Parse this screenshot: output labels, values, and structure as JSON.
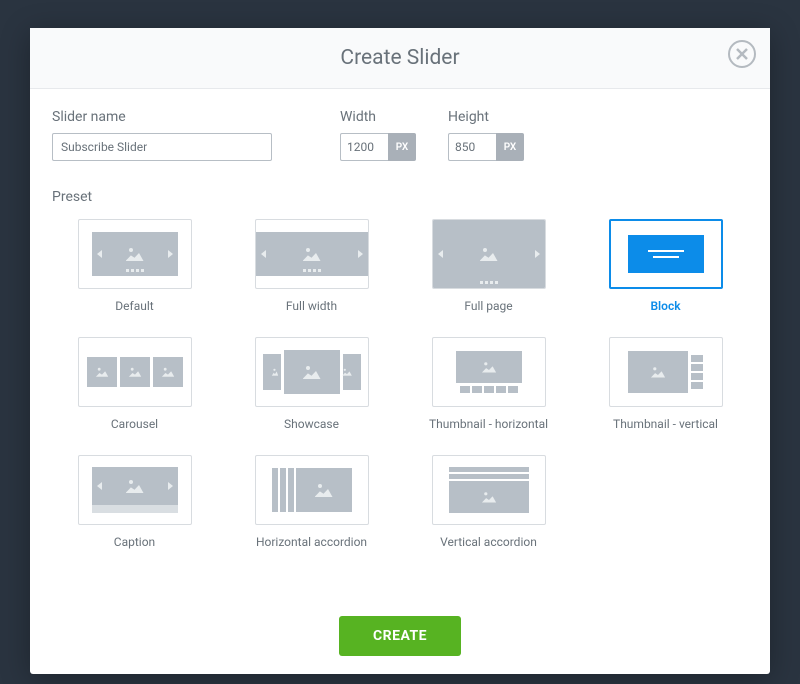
{
  "modal": {
    "title": "Create Slider"
  },
  "form": {
    "name_label": "Slider name",
    "name_value": "Subscribe Slider",
    "width_label": "Width",
    "width_value": "1200",
    "height_label": "Height",
    "height_value": "850",
    "unit": "PX"
  },
  "preset": {
    "label": "Preset",
    "selected": "block",
    "items": [
      {
        "id": "default",
        "label": "Default"
      },
      {
        "id": "fullwidth",
        "label": "Full width"
      },
      {
        "id": "fullpage",
        "label": "Full page"
      },
      {
        "id": "block",
        "label": "Block"
      },
      {
        "id": "carousel",
        "label": "Carousel"
      },
      {
        "id": "showcase",
        "label": "Showcase"
      },
      {
        "id": "thumb-h",
        "label": "Thumbnail - horizontal"
      },
      {
        "id": "thumb-v",
        "label": "Thumbnail - vertical"
      },
      {
        "id": "caption",
        "label": "Caption"
      },
      {
        "id": "h-accordion",
        "label": "Horizontal accordion"
      },
      {
        "id": "v-accordion",
        "label": "Vertical accordion"
      }
    ]
  },
  "actions": {
    "create": "CREATE"
  }
}
